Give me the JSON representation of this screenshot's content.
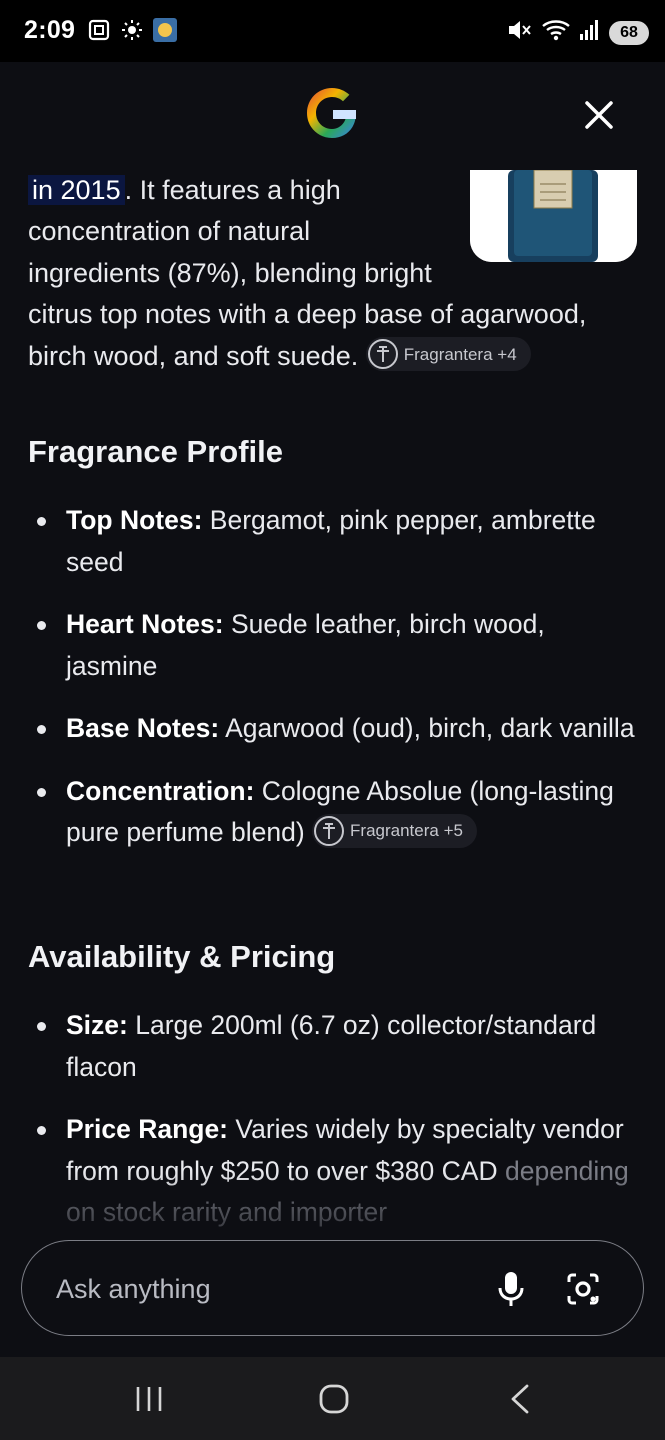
{
  "status_bar": {
    "time": "2:09",
    "battery": "68",
    "left_icons": [
      "screenshot-icon",
      "brightness-icon",
      "weather-icon"
    ],
    "right_icons": [
      "mute-icon",
      "wifi-icon",
      "signal-icon",
      "battery-icon"
    ]
  },
  "header": {
    "logo": "google-g-logo",
    "close_icon": "close-icon"
  },
  "intro": {
    "year_highlight": "in 2015",
    "text_line1": ". It features a high",
    "text_rest": "concentration of natural ingredients (87%), blending bright citrus top notes with a deep base of agarwood, birch wood, and soft suede.",
    "source_chip": "Fragrantera +4"
  },
  "sections": {
    "profile_heading": "Fragrance Profile",
    "profile_items": [
      {
        "label": "Top Notes:",
        "text": " Bergamot, pink pepper, ambrette seed"
      },
      {
        "label": "Heart Notes:",
        "text": " Suede leather, birch wood, jasmine"
      },
      {
        "label": "Base Notes:",
        "text": " Agarwood (oud), birch, dark vanilla"
      },
      {
        "label": "Concentration:",
        "text": " Cologne Absolue (long-lasting pure perfume blend)"
      }
    ],
    "profile_chip": "Fragrantera +5",
    "availability_heading": "Availability & Pricing",
    "availability_items": [
      {
        "label": "Size:",
        "text": " Large 200ml (6.7 oz) collector/standard flacon"
      },
      {
        "label": "Price Range:",
        "text": " Varies widely by specialty vendor from roughly $250 to over $380 CAD",
        "faded_text": "depending on stock rarity and importer"
      }
    ]
  },
  "ask_bar": {
    "placeholder": "Ask anything",
    "mic_icon": "microphone-icon",
    "lens_icon": "camera-search-icon"
  },
  "nav_bar": {
    "buttons": [
      "recents-icon",
      "home-icon",
      "back-icon"
    ]
  },
  "colors": {
    "background": "#0d0e13",
    "chip_bg": "#1c1d24",
    "highlight": "#0b1640"
  }
}
